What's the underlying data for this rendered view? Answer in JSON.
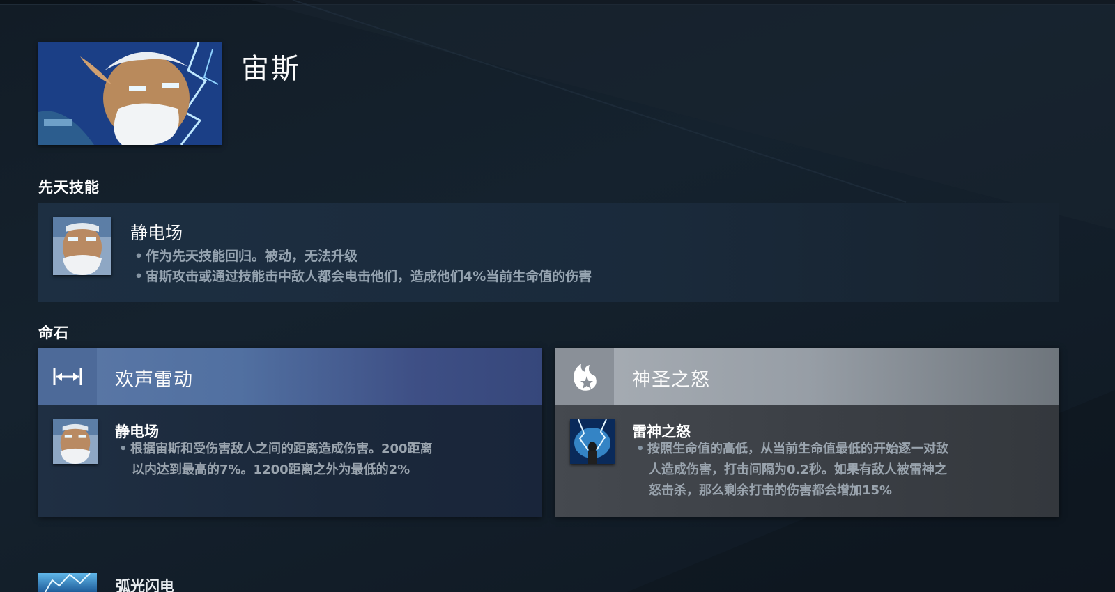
{
  "hero": {
    "name": "宙斯",
    "portrait_icon": "zeus-portrait-icon"
  },
  "innate": {
    "section_title": "先天技能",
    "ability_name": "静电场",
    "icon": "zeus-face-icon",
    "lines": [
      "作为先天技能回归。被动，无法升级",
      "宙斯攻击或通过技能击中敌人都会电击他们，造成他们4%当前生命值的伤害"
    ]
  },
  "facets": {
    "section_title": "命石",
    "left": {
      "title": "欢声雷动",
      "head_icon": "range-arrows-icon",
      "color": "#5b78a6",
      "ability_name": "静电场",
      "ability_icon": "zeus-face-icon",
      "lines": [
        "根据宙斯和受伤害敌人之间的距离造成伤害。200距离",
        "以内达到最高的7%。1200距离之外为最低的2%"
      ]
    },
    "right": {
      "title": "神圣之怒",
      "head_icon": "divine-flame-icon",
      "color": "#a8aeb5",
      "ability_name": "雷神之怒",
      "ability_icon": "thundergods-wrath-icon",
      "lines": [
        "按照生命值的高低，从当前生命值最低的开始逐一对敌",
        "人造成伤害，打击间隔为0.2秒。如果有敌人被雷神之",
        "怒击杀，那么剩余打击的伤害都会增加15%"
      ]
    }
  },
  "next_ability": {
    "name": "弧光闪电",
    "icon": "arc-lightning-icon"
  }
}
